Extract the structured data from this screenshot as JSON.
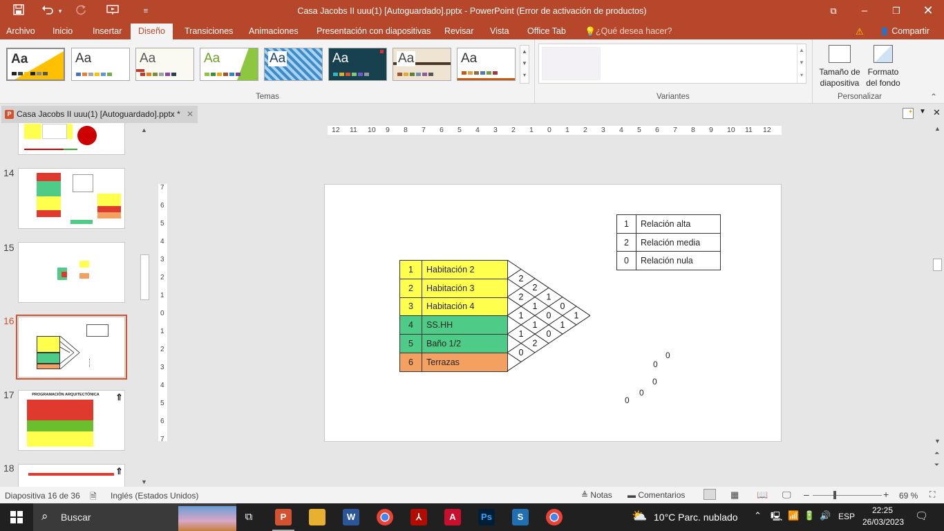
{
  "window": {
    "title": "Casa Jacobs II uuu(1) [Autoguardado].pptx - PowerPoint (Error de activación de productos)"
  },
  "menu": {
    "items": [
      "Archivo",
      "Inicio",
      "Insertar",
      "Diseño",
      "Transiciones",
      "Animaciones",
      "Presentación con diapositivas",
      "Revisar",
      "Vista",
      "Office Tab"
    ],
    "search_placeholder": "¿Qué desea hacer?",
    "share": "Compartir",
    "active": "Diseño"
  },
  "ribbon": {
    "theme_glyph": "Aa",
    "groups": {
      "themes": "Temas",
      "variants": "Variantes",
      "customize": "Personalizar"
    },
    "slide_size": "Tamaño de diapositiva",
    "format_bg": "Formato del fondo"
  },
  "doc_tab": {
    "name": "Casa Jacobs II uuu(1) [Autoguardado].pptx *"
  },
  "thumbnails": {
    "numbers": [
      "14",
      "15",
      "16",
      "17",
      "18"
    ],
    "selected": "16",
    "t17_title": "PROGRAMACIÓN ARQUITECTÓNICA"
  },
  "ruler": {
    "h_ticks": [
      "12",
      "11",
      "10",
      "9",
      "8",
      "7",
      "6",
      "5",
      "4",
      "3",
      "2",
      "1",
      "0",
      "1",
      "2",
      "3",
      "4",
      "5",
      "6",
      "7",
      "8",
      "9",
      "10",
      "11",
      "12"
    ],
    "v_ticks": [
      "7",
      "6",
      "5",
      "4",
      "3",
      "2",
      "1",
      "0",
      "1",
      "2",
      "3",
      "4",
      "5",
      "6",
      "7"
    ]
  },
  "slide": {
    "program": [
      {
        "n": "1",
        "label": "Habitación 2",
        "color": "#ffff4d"
      },
      {
        "n": "2",
        "label": "Habitación 3",
        "color": "#ffff4d"
      },
      {
        "n": "3",
        "label": "Habitación 4",
        "color": "#ffff4d"
      },
      {
        "n": "4",
        "label": "SS.HH",
        "color": "#4ecb86"
      },
      {
        "n": "5",
        "label": "Baño 1/2",
        "color": "#4ecb86"
      },
      {
        "n": "6",
        "label": "Terrazas",
        "color": "#f4a060"
      }
    ],
    "matrix_values": [
      "2",
      "2",
      "2",
      "1",
      "1",
      "1",
      "1",
      "1",
      "0",
      "0",
      "0",
      "2",
      "0",
      "1",
      "1"
    ],
    "legend": [
      {
        "n": "1",
        "label": "Relación alta"
      },
      {
        "n": "2",
        "label": "Relación media"
      },
      {
        "n": "0",
        "label": "Relación nula"
      }
    ],
    "stray_zeros": [
      "0",
      "0",
      "0",
      "0",
      "0"
    ]
  },
  "status": {
    "slide_info": "Diapositiva 16 de 36",
    "language": "Inglés (Estados Unidos)",
    "notes": "Notas",
    "comments": "Comentarios",
    "zoom": "69 %"
  },
  "taskbar": {
    "search": "Buscar",
    "weather": "10°C  Parc. nublado",
    "lang": "ESP",
    "time": "22:25",
    "date": "26/03/2023"
  }
}
